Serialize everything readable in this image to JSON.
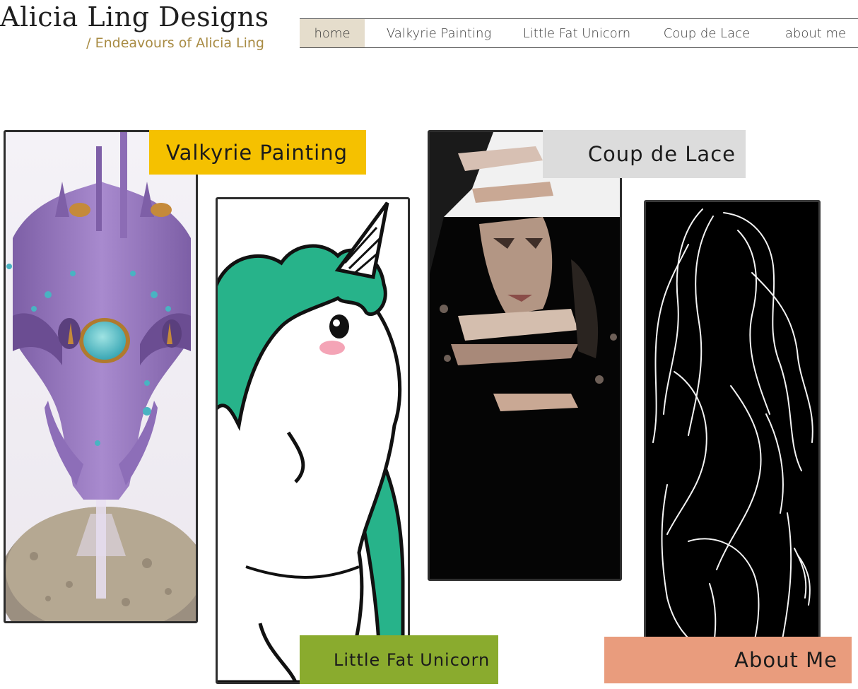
{
  "header": {
    "title": "Alicia Ling Designs",
    "subtitle": "/ Endeavours of Alicia Ling"
  },
  "nav": {
    "items": [
      {
        "label": "home",
        "active": true
      },
      {
        "label": "Valkyrie Painting",
        "active": false
      },
      {
        "label": "Little Fat Unicorn",
        "active": false
      },
      {
        "label": "Coup de Lace",
        "active": false
      },
      {
        "label": "about me",
        "active": false
      }
    ]
  },
  "cards": {
    "valkyrie": {
      "label": "Valkyrie Painting",
      "color": "#f5c100"
    },
    "unicorn": {
      "label": "Little Fat Unicorn",
      "color": "#8aab2e"
    },
    "lace": {
      "label": "Coup de Lace",
      "color": "#dcdcdc"
    },
    "about": {
      "label": "About Me",
      "color": "#e99c7d"
    }
  },
  "colors": {
    "accent_gold": "#a88b43",
    "nav_active_bg": "#e5ddcc",
    "border": "#2d2d2d"
  }
}
